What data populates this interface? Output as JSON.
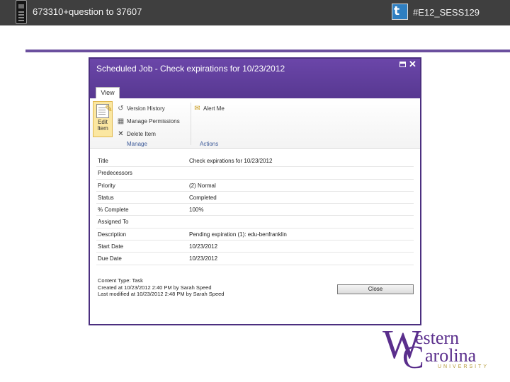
{
  "slide": {
    "top_left_text": "673310+question to 37607",
    "top_right_text": "#E12_SESS129"
  },
  "dialog": {
    "title": "Scheduled Job - Check expirations for 10/23/2012",
    "tab": "View",
    "ribbon": {
      "edit_label": "Edit Item",
      "version_history": "Version History",
      "manage_permissions": "Manage Permissions",
      "delete_item": "Delete Item",
      "alert_me": "Alert Me",
      "group_manage": "Manage",
      "group_actions": "Actions"
    },
    "fields": [
      {
        "label": "Title",
        "value": "Check expirations for 10/23/2012"
      },
      {
        "label": "Predecessors",
        "value": ""
      },
      {
        "label": "Priority",
        "value": "(2) Normal"
      },
      {
        "label": "Status",
        "value": "Completed"
      },
      {
        "label": "% Complete",
        "value": "100%"
      },
      {
        "label": "Assigned To",
        "value": ""
      },
      {
        "label": "Description",
        "value": "Pending expiration (1): edu-benfranklin"
      },
      {
        "label": "Start Date",
        "value": "10/23/2012"
      },
      {
        "label": "Due Date",
        "value": "10/23/2012"
      }
    ],
    "footer": {
      "content_type": "Content Type: Task",
      "created": "Created at 10/23/2012 2:40 PM by Sarah Speed",
      "modified": "Last modified at 10/23/2012 2:48 PM by Sarah Speed"
    },
    "close_label": "Close"
  },
  "logo": {
    "letter_w": "W",
    "word1": "estern",
    "letter_c": "C",
    "word2": "arolina",
    "word3": "UNIVERSITY"
  },
  "colors": {
    "topbar": "#3f3f3f",
    "accent_purple": "#5a2e8c",
    "dialog_header": "#5f3d9c",
    "logo_gold": "#b59a3a"
  },
  "icons": [
    "phone-icon",
    "twitter-icon",
    "maximize-icon",
    "close-icon",
    "edit-icon",
    "version-history-icon",
    "manage-permissions-icon",
    "delete-icon",
    "alert-icon"
  ]
}
